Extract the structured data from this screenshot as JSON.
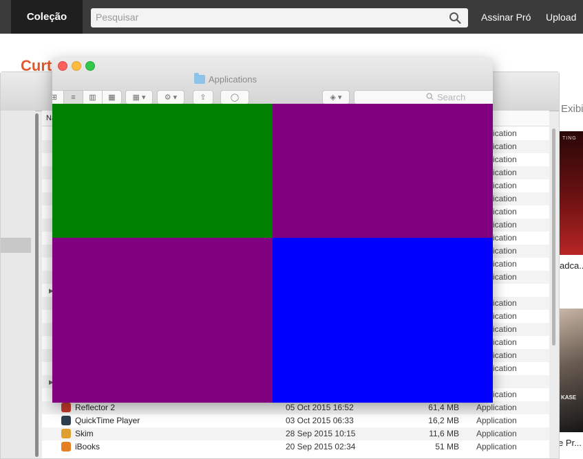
{
  "header": {
    "brand": "Coleção",
    "search_placeholder": "Pesquisar",
    "link_pro": "Assinar Pró",
    "link_upload": "Upload"
  },
  "page": {
    "title_partial": "Curt",
    "side_label_partial": "Exibi",
    "thumb1_caption": "adca...",
    "thumb1_text": "TING",
    "thumb2_caption": "e Pr...",
    "thumb2_text": "KASE"
  },
  "front_window": {
    "title": "Applications",
    "search_placeholder": "Search",
    "quadrant_colors": [
      "#008000",
      "#800080",
      "#800080",
      "#0000ff"
    ]
  },
  "list": {
    "column_name_partial": "Na",
    "kind_partial_rows": [
      "Application",
      "Application",
      "Application",
      "Application",
      "Application",
      "Application",
      "Application",
      "Application",
      "Application",
      "Application",
      "Application",
      "Application",
      "er",
      "Application",
      "Application",
      "Application",
      "Application",
      "Application",
      "Application",
      "er",
      "Application"
    ],
    "rows": [
      {
        "name": "Reflector 2",
        "date": "05 Oct 2015 16:52",
        "size": "61,4 MB",
        "kind": "Application",
        "icon_color": "#c0392b"
      },
      {
        "name": "QuickTime Player",
        "date": "03 Oct 2015 06:33",
        "size": "16,2 MB",
        "kind": "Application",
        "icon_color": "#2c3e50"
      },
      {
        "name": "Skim",
        "date": "28 Sep 2015 10:15",
        "size": "11,6 MB",
        "kind": "Application",
        "icon_color": "#e0a030"
      },
      {
        "name": "iBooks",
        "date": "20 Sep 2015 02:34",
        "size": "51 MB",
        "kind": "Application",
        "icon_color": "#e67e22"
      }
    ]
  }
}
